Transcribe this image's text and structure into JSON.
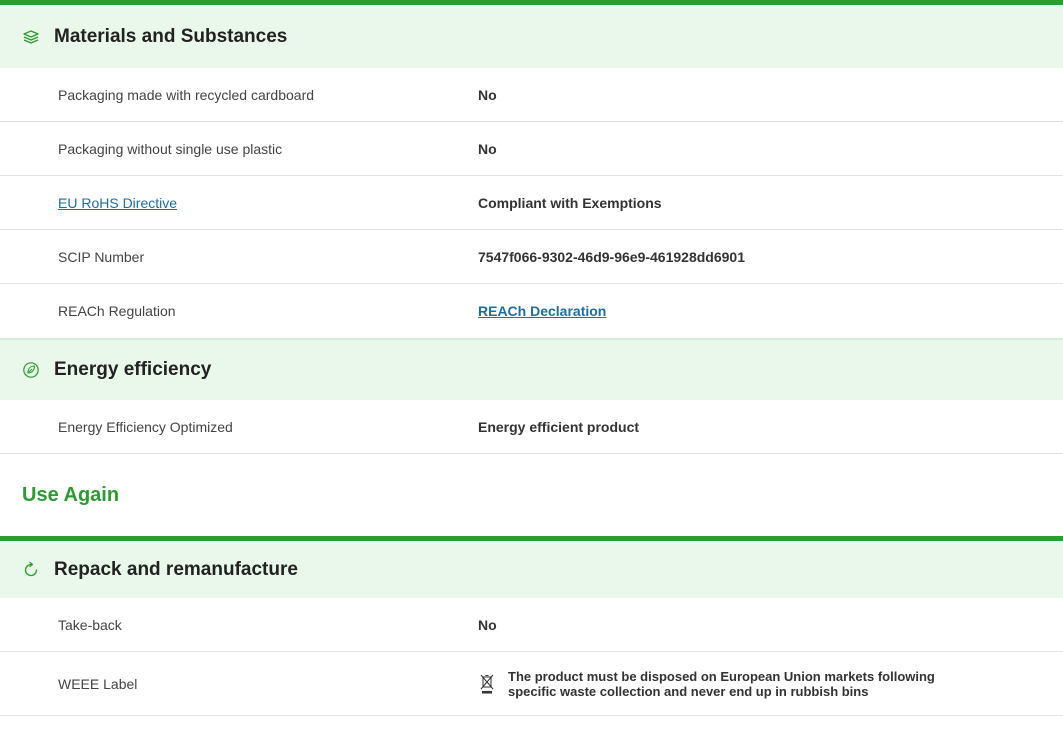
{
  "materials": {
    "title": "Materials and Substances",
    "icon": "layers-icon",
    "rows": [
      {
        "label": "Packaging made with recycled cardboard",
        "value": "No"
      },
      {
        "label": "Packaging without single use plastic",
        "value": "No"
      },
      {
        "label": "EU RoHS Directive",
        "value": "Compliant with Exemptions"
      },
      {
        "label": "SCIP Number",
        "value": "7547f066-9302-46d9-96e9-461928dd6901"
      },
      {
        "label": "REACh Regulation",
        "value": "REACh Declaration"
      }
    ]
  },
  "energy": {
    "title": "Energy efficiency",
    "icon": "leaf-badge-icon",
    "rows": [
      {
        "label": "Energy Efficiency Optimized",
        "value": "Energy efficient product"
      }
    ]
  },
  "use_again": {
    "group_title": "Use Again"
  },
  "repack": {
    "title": "Repack and remanufacture",
    "icon": "refresh-icon",
    "rows": [
      {
        "label": "Take-back",
        "value": "No"
      },
      {
        "label": "WEEE Label",
        "value": "The product must be disposed on European Union markets following specific waste collection and never end up in rubbish bins"
      }
    ]
  },
  "colors": {
    "accent": "#2a9d2f",
    "header_bg": "#e9f8ea",
    "link": "#1a6fa8"
  }
}
